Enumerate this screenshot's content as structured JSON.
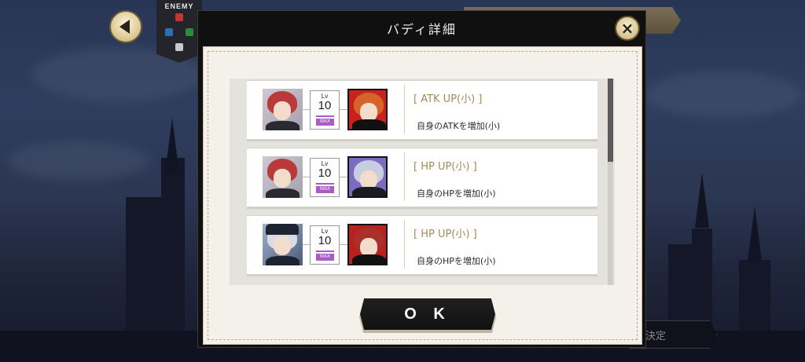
{
  "background": {
    "enemy_label": "ENEMY",
    "decide_label": "決定"
  },
  "modal": {
    "title": "バディ詳細",
    "close_glyph": "×",
    "ok_label": "O K"
  },
  "buddies": [
    {
      "level_prefix": "Lv",
      "level": "10",
      "max_badge": "MAX",
      "skill_name": "[ ATK UP(小) ]",
      "skill_desc": "自身のATKを増加(小)",
      "left_hair": "#b83a3a",
      "right_hair": "#d8632a",
      "right_bg": "#c8221c"
    },
    {
      "level_prefix": "Lv",
      "level": "10",
      "max_badge": "MAX",
      "skill_name": "[ HP UP(小) ]",
      "skill_desc": "自身のHPを増加(小)",
      "left_hair": "#b83a3a",
      "right_hair": "#c9cde0",
      "right_bg": "#7c6cc0"
    },
    {
      "level_prefix": "Lv",
      "level": "10",
      "max_badge": "MAX",
      "skill_name": "[ HP UP(小) ]",
      "skill_desc": "自身のHPを増加(小)",
      "left_hair": "#d9dbe6",
      "right_hair": "#a8322b",
      "right_bg": "#b8221e"
    }
  ],
  "colors": {
    "accent_gold": "#a48a56",
    "max_purple": "#a85cc4"
  }
}
